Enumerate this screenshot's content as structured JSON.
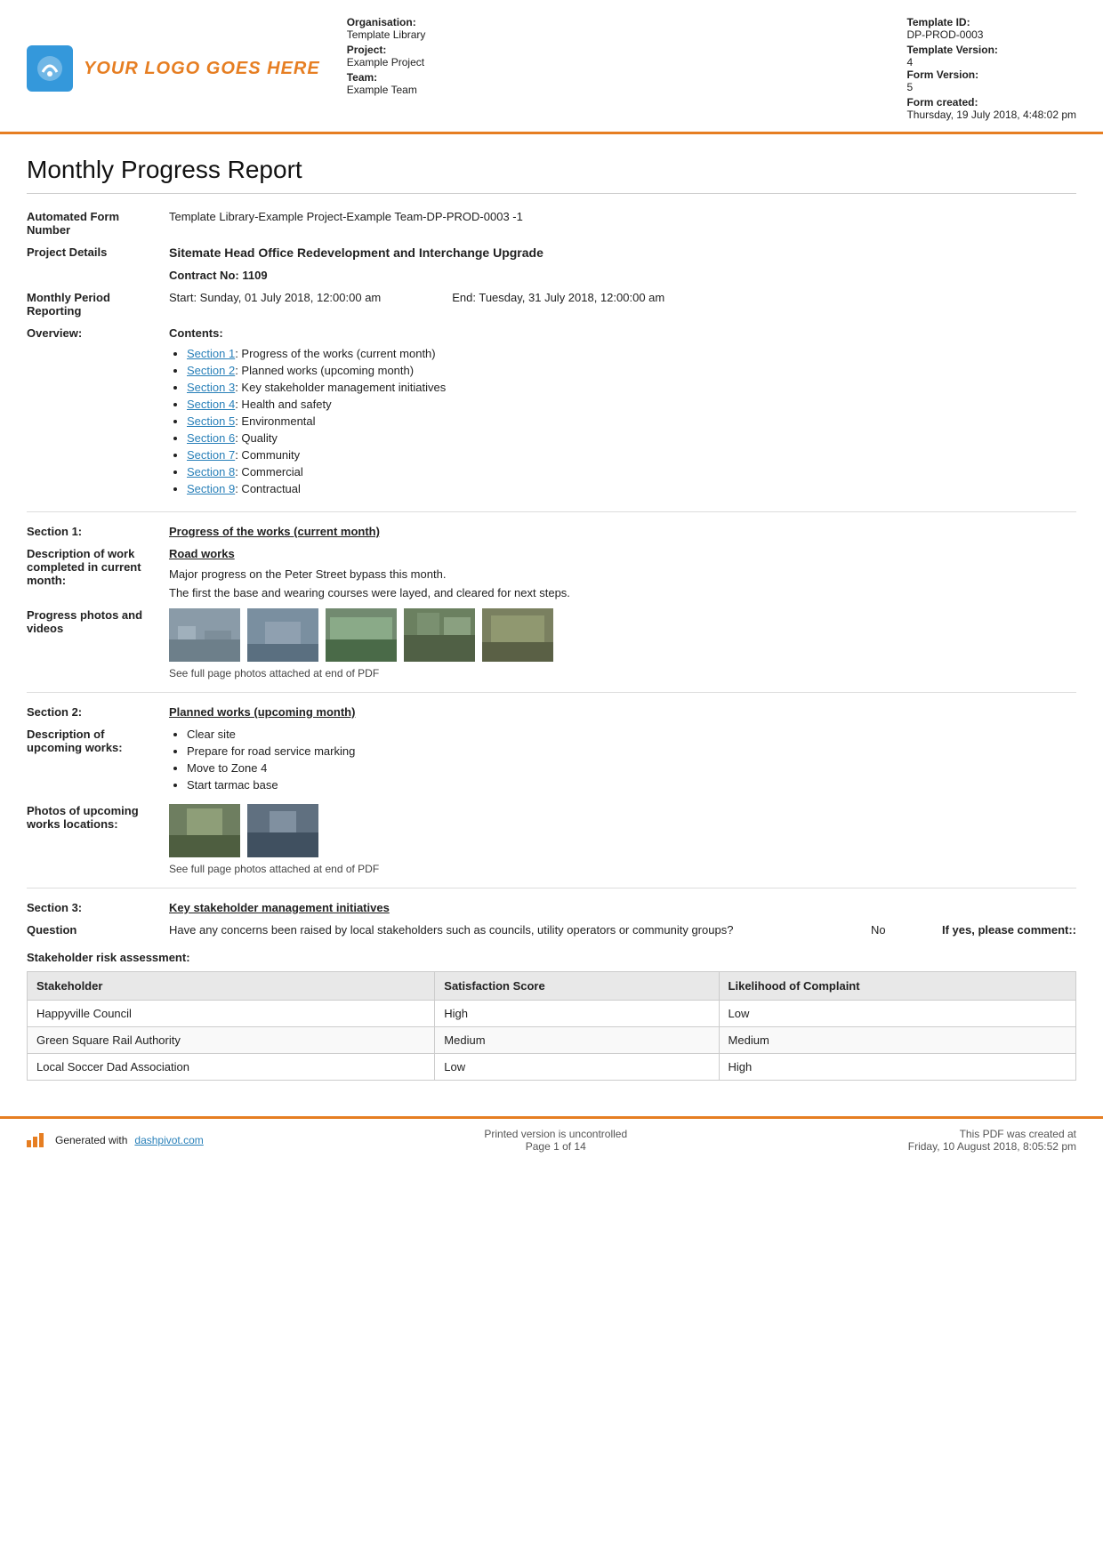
{
  "header": {
    "logo_text": "YOUR LOGO GOES HERE",
    "org_label": "Organisation:",
    "org_value": "Template Library",
    "project_label": "Project:",
    "project_value": "Example Project",
    "team_label": "Team:",
    "team_value": "Example Team",
    "template_id_label": "Template ID:",
    "template_id_value": "DP-PROD-0003",
    "template_version_label": "Template Version:",
    "template_version_value": "4",
    "form_version_label": "Form Version:",
    "form_version_value": "5",
    "form_created_label": "Form created:",
    "form_created_value": "Thursday, 19 July 2018, 4:48:02 pm"
  },
  "report": {
    "title": "Monthly Progress Report",
    "form_number_label": "Automated Form Number",
    "form_number_value": "Template Library-Example Project-Example Team-DP-PROD-0003   -1",
    "project_details_label": "Project Details",
    "project_details_value": "Sitemate Head Office Redevelopment and Interchange Upgrade",
    "contract_label": "Contract No:",
    "contract_value": "1109",
    "period_label": "Monthly Period Reporting",
    "period_start": "Start: Sunday, 01 July 2018, 12:00:00 am",
    "period_end": "End: Tuesday, 31 July 2018, 12:00:00 am",
    "overview_label": "Overview:",
    "contents_heading": "Contents:",
    "contents_items": [
      {
        "link": "Section 1",
        "text": ": Progress of the works (current month)"
      },
      {
        "link": "Section 2",
        "text": ": Planned works (upcoming month)"
      },
      {
        "link": "Section 3",
        "text": ": Key stakeholder management initiatives"
      },
      {
        "link": "Section 4",
        "text": ": Health and safety"
      },
      {
        "link": "Section 5",
        "text": ": Environmental"
      },
      {
        "link": "Section 6",
        "text": ": Quality"
      },
      {
        "link": "Section 7",
        "text": ": Community"
      },
      {
        "link": "Section 8",
        "text": ": Commercial"
      },
      {
        "link": "Section 9",
        "text": ": Contractual"
      }
    ],
    "section1_label": "Section 1:",
    "section1_heading": "Progress of the works (current month)",
    "desc_work_label": "Description of work completed in current month:",
    "desc_work_heading": "Road works",
    "desc_work_text1": "Major progress on the Peter Street bypass this month.",
    "desc_work_text2": "The first the base and wearing courses were layed, and cleared for next steps.",
    "photos_label": "Progress photos and videos",
    "photos_caption": "See full page photos attached at end of PDF",
    "section2_label": "Section 2:",
    "section2_heading": "Planned works (upcoming month)",
    "upcoming_label": "Description of upcoming works:",
    "upcoming_items": [
      "Clear site",
      "Prepare for road service marking",
      "Move to Zone 4",
      "Start tarmac base"
    ],
    "upcoming_photos_label": "Photos of upcoming works locations:",
    "upcoming_photos_caption": "See full page photos attached at end of PDF",
    "section3_label": "Section 3:",
    "section3_heading": "Key stakeholder management initiatives",
    "question_label": "Question",
    "question_text": "Have any concerns been raised by local stakeholders such as councils, utility operators or community groups?",
    "question_answer": "No",
    "question_comment": "If yes, please comment::",
    "stake_heading": "Stakeholder risk assessment:",
    "table": {
      "headers": [
        "Stakeholder",
        "Satisfaction Score",
        "Likelihood of Complaint"
      ],
      "rows": [
        [
          "Happyville Council",
          "High",
          "Low"
        ],
        [
          "Green Square Rail Authority",
          "Medium",
          "Medium"
        ],
        [
          "Local Soccer Dad Association",
          "Low",
          "High"
        ]
      ]
    }
  },
  "footer": {
    "brand_text": "Generated with",
    "brand_link_text": "dashpivot.com",
    "print_notice": "Printed version is uncontrolled",
    "page_info": "Page 1 of 14",
    "pdf_info": "This PDF was created at",
    "pdf_date": "Friday, 10 August 2018, 8:05:52 pm"
  }
}
